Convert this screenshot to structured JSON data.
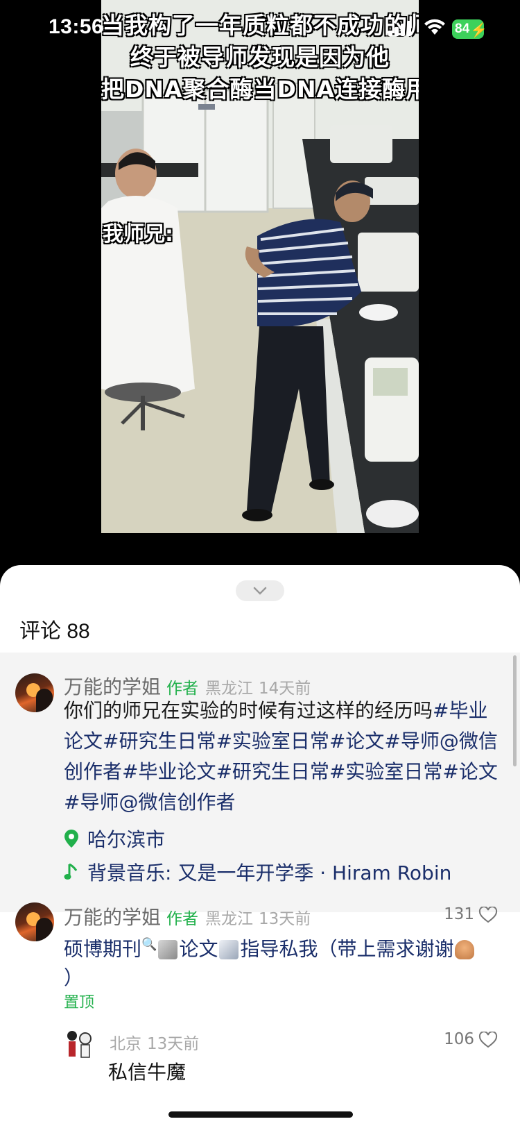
{
  "status_bar": {
    "time": "13:56",
    "battery": "84"
  },
  "video": {
    "caption_lines": [
      "当我构了一年质粒都不成功的师兄",
      "终于被导师发现是因为他",
      "把DNA聚合酶当DNA连接酶用时"
    ],
    "speaker_label": "我师兄:"
  },
  "comments_panel": {
    "title": "评论 88",
    "post": {
      "author": "万能的学姐",
      "author_tag": "作者",
      "region": "黑龙江",
      "time": "14天前",
      "body_plain": "你们的师兄在实验的时候有过这样的经历吗",
      "body_tags": "#毕业论文#研究生日常#实验室日常#论文#导师@微信创作者#毕业论文#研究生日常#实验室日常#论文#导师@微信创作者",
      "location": "哈尔滨市",
      "music": "背景音乐: 又是一年开学季 · Hiram Robin"
    },
    "comments": [
      {
        "author": "万能的学姐",
        "author_tag": "作者",
        "region": "黑龙江",
        "time": "13天前",
        "likes": "131",
        "text_a": "硕博期刊",
        "text_b": "论文",
        "text_c": "指导私我（带上需求谢谢",
        "text_d": "）",
        "pinned": "置顶"
      },
      {
        "region": "北京",
        "time": "13天前",
        "likes": "106",
        "text": "私信牛魔"
      }
    ]
  },
  "colors": {
    "accent_green": "#21b04b",
    "link_blue": "#1a2e6a",
    "battery_green": "#3dd15b"
  }
}
